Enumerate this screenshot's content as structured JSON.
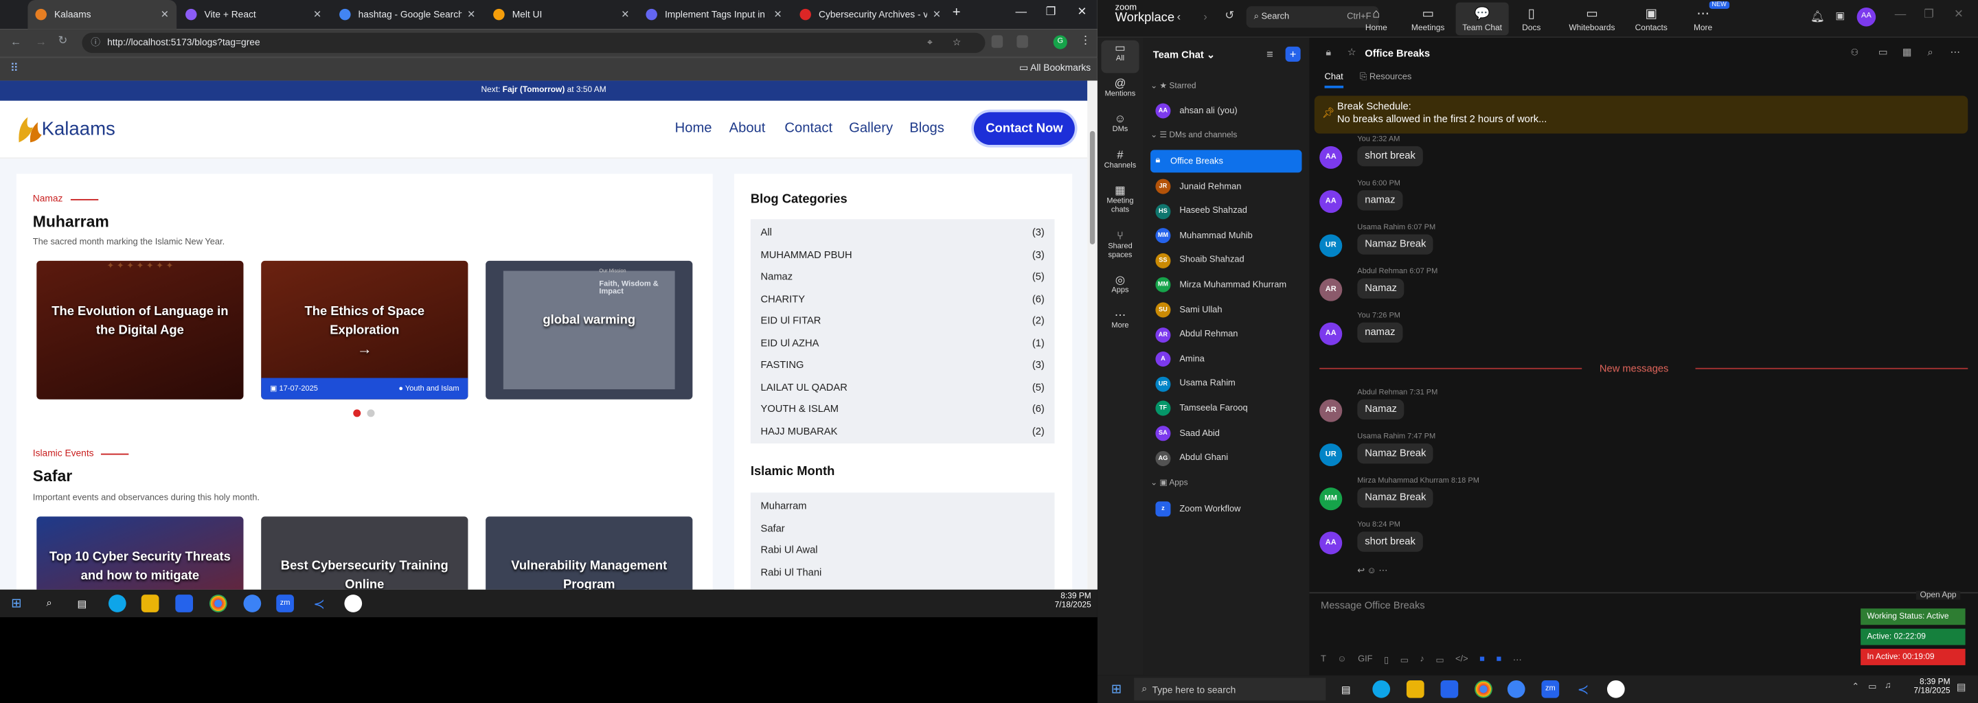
{
  "browser": {
    "tabs": [
      {
        "title": "Kalaams",
        "color": "#e67e22"
      },
      {
        "title": "Vite + React",
        "color": "#8b5cf6"
      },
      {
        "title": "hashtag - Google Search",
        "color": "#4285f4"
      },
      {
        "title": "Melt UI",
        "color": "#f59e0b"
      },
      {
        "title": "Implement Tags Input in Blo",
        "color": "#6366f1"
      },
      {
        "title": "Cybersecurity Archives - vC",
        "color": "#dc2626"
      }
    ],
    "url": "http://localhost:5173/blogs?tag=gree",
    "bookmarks_label": "All Bookmarks"
  },
  "site": {
    "prayer_prefix": "Next: ",
    "prayer_name": "Fajr (Tomorrow)",
    "prayer_suffix": " at 3:50 AM",
    "logo": "Kalaams",
    "nav": [
      "Home",
      "About",
      "Contact",
      "Gallery",
      "Blogs"
    ],
    "cta": "Contact Now",
    "section1": {
      "eyebrow": "Namaz",
      "title": "Muharram",
      "subtitle": "The sacred month marking the Islamic New Year.",
      "blogs": [
        {
          "title": "The Evolution of Language in the Digital Age"
        },
        {
          "title": "The Ethics of Space Exploration",
          "date": "17-07-2025",
          "category": "Youth and Islam",
          "arrow": "→"
        },
        {
          "title": "global warming",
          "hint_title": "Faith, Wisdom & Impact",
          "hint_sub": "Our Mission"
        }
      ]
    },
    "section2": {
      "eyebrow": "Islamic Events",
      "title": "Safar",
      "subtitle": "Important events and observances during this holy month.",
      "blogs": [
        {
          "title": "Top 10 Cyber Security Threats and how to mitigate"
        },
        {
          "title": "Best Cybersecurity Training Online"
        },
        {
          "title": "Vulnerability Management Program"
        }
      ]
    },
    "categories_title": "Blog Categories",
    "categories": [
      {
        "name": "All",
        "count": "(3)"
      },
      {
        "name": "MUHAMMAD PBUH",
        "count": "(3)"
      },
      {
        "name": "Namaz",
        "count": "(5)"
      },
      {
        "name": "CHARITY",
        "count": "(6)"
      },
      {
        "name": "EID Ul FITAR",
        "count": "(2)"
      },
      {
        "name": "EID Ul AZHA",
        "count": "(1)"
      },
      {
        "name": "FASTING",
        "count": "(3)"
      },
      {
        "name": "LAILAT UL QADAR",
        "count": "(5)"
      },
      {
        "name": "YOUTH & ISLAM",
        "count": "(6)"
      },
      {
        "name": "HAJJ MUBARAK",
        "count": "(2)"
      }
    ],
    "months_title": "Islamic Month",
    "months": [
      "Muharram",
      "Safar",
      "Rabi Ul Awal",
      "Rabi Ul Thani"
    ]
  },
  "taskbar_left": {
    "time": "8:39 PM",
    "date": "7/18/2025"
  },
  "zoom": {
    "brand1": "zoom",
    "brand2": "Workplace",
    "search": "Search",
    "shortcut": "Ctrl+F",
    "tabs": [
      "Home",
      "Meetings",
      "Team Chat",
      "Docs",
      "Whiteboards",
      "Contacts",
      "More"
    ],
    "new_badge": "NEW",
    "avatar": "AA",
    "rail": [
      "All",
      "Mentions",
      "DMs",
      "Channels",
      "Meeting chats",
      "Shared spaces",
      "Apps",
      "More"
    ],
    "list_title": "Team Chat",
    "starred": "Starred",
    "self": "ahsan ali (you)",
    "dms_header": "DMs and channels",
    "active_channel": "Office Breaks",
    "people": [
      {
        "name": "Junaid Rehman",
        "ini": "JR",
        "color": "#b45309"
      },
      {
        "name": "Haseeb Shahzad",
        "ini": "HS",
        "color": "#0f766e"
      },
      {
        "name": "Muhammad Muhib",
        "ini": "MM",
        "color": "#2563eb"
      },
      {
        "name": "Shoaib Shahzad",
        "ini": "SS",
        "color": "#ca8a04"
      },
      {
        "name": "Mirza Muhammad Khurram",
        "ini": "MM",
        "color": "#16a34a"
      },
      {
        "name": "Sami Ullah",
        "ini": "SU",
        "color": "#ca8a04"
      },
      {
        "name": "Abdul Rehman",
        "ini": "AR",
        "color": "#7c3aed"
      },
      {
        "name": "Amina",
        "ini": "A",
        "color": "#7c3aed"
      },
      {
        "name": "Usama Rahim",
        "ini": "UR",
        "color": "#0284c7"
      },
      {
        "name": "Tamseela Farooq",
        "ini": "TF",
        "color": "#059669"
      },
      {
        "name": "Saad Abid",
        "ini": "SA",
        "color": "#7c3aed"
      },
      {
        "name": "Abdul Ghani",
        "ini": "AG",
        "color": "#525252"
      }
    ],
    "apps_header": "Apps",
    "app": "Zoom Workflow",
    "channel_title": "Office Breaks",
    "chat_tabs": [
      "Chat",
      "Resources"
    ],
    "pinned_title": "Break Schedule:",
    "pinned_text": "No breaks allowed in the first 2 hours of work...",
    "messages": [
      {
        "who": "You 2:32 AM",
        "text": "short break",
        "ini": "AA",
        "color": "#7c3aed"
      },
      {
        "who": "You 6:00 PM",
        "text": "namaz",
        "ini": "AA",
        "color": "#7c3aed"
      },
      {
        "who": "Usama Rahim 6:07 PM",
        "text": "Namaz Break",
        "ini": "UR",
        "color": "#0284c7"
      },
      {
        "who": "Abdul Rehman 6:07 PM",
        "text": "Namaz",
        "ini": "AR",
        "color": "#8b5a6b"
      },
      {
        "who": "You 7:26 PM",
        "text": "namaz",
        "ini": "AA",
        "color": "#7c3aed"
      },
      {
        "who": "Abdul Rehman 7:31 PM",
        "text": "Namaz",
        "ini": "AR",
        "color": "#8b5a6b"
      },
      {
        "who": "Usama Rahim 7:47 PM",
        "text": "Namaz Break",
        "ini": "UR",
        "color": "#0284c7"
      },
      {
        "who": "Mirza Muhammad Khurram 8:18 PM",
        "text": "Namaz Break",
        "ini": "MM",
        "color": "#16a34a"
      },
      {
        "who": "You 8:24 PM",
        "text": "short break",
        "ini": "AA",
        "color": "#7c3aed"
      }
    ],
    "new_messages": "New messages",
    "compose_placeholder": "Message Office Breaks",
    "open_app": "Open App",
    "status": {
      "working": "Working Status: Active",
      "active": "Active: 02:22:09",
      "inactive": "In Active: 00:19:09"
    }
  },
  "taskbar_right": {
    "search": "Type here to search",
    "time": "8:39 PM",
    "date": "7/18/2025"
  }
}
